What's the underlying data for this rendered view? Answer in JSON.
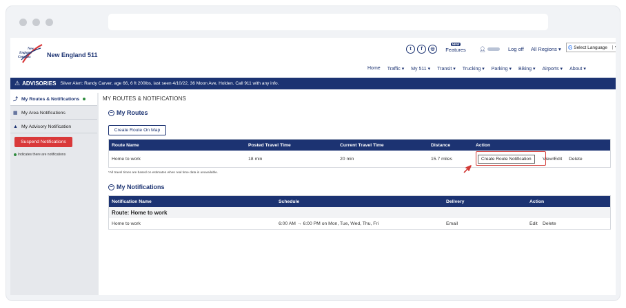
{
  "header": {
    "brand": "New England 511",
    "logo_text": "New England Compass",
    "social_icons": [
      "twitter-icon",
      "facebook-icon",
      "instagram-icon"
    ],
    "features_badge": "NEW",
    "features_label": "Features",
    "logoff_label": "Log off",
    "regions_label": "All Regions ▾",
    "language_label": "Select Language",
    "language_arrow": "▼",
    "nav": [
      "Home",
      "Traffic ▾",
      "My 511 ▾",
      "Transit ▾",
      "Trucking ▾",
      "Parking ▾",
      "Biking ▾",
      "Airports ▾",
      "About ▾"
    ]
  },
  "advisory": {
    "title": "ADVISORIES",
    "text": "Silver Alert: Randy Carver, age 66, 6 ft 200lbs, last seen 4/10/22, 36 Moon Ave, Holden. Call 911 with any info."
  },
  "sidebar": {
    "items": [
      {
        "label": "My Routes & Notifications",
        "icon": "route-icon"
      },
      {
        "label": "My Area Notifications",
        "icon": "map-icon"
      },
      {
        "label": "My Advisory Notification",
        "icon": "warning-icon"
      }
    ],
    "suspend_label": "Suspend Notifications",
    "indicator_note": "Indicates there are notifications"
  },
  "main": {
    "breadcrumb": "MY ROUTES & NOTIFICATIONS",
    "routes": {
      "heading": "My Routes",
      "create_button": "Create Route On Map",
      "columns": [
        "Route Name",
        "Posted Travel Time",
        "Current Travel Time",
        "Distance",
        "Action"
      ],
      "rows": [
        {
          "name": "Home to work",
          "posted": "18 min",
          "current": "20 min",
          "distance": "15.7 miles",
          "action_primary": "Create Route Notification",
          "action_view": "View/Edit",
          "action_delete": "Delete"
        }
      ],
      "footnote": "*All travel times are based on estimates when real time data is unavailable."
    },
    "notifications": {
      "heading": "My Notifications",
      "columns": [
        "Notification Name",
        "Schedule",
        "Delivery",
        "Action"
      ],
      "group_label": "Route: Home to work",
      "rows": [
        {
          "name": "Home to work",
          "schedule": "6:00 AM → 6:00 PM on Mon, Tue, Wed, Thu, Fri",
          "delivery": "Email",
          "action_edit": "Edit",
          "action_delete": "Delete"
        }
      ]
    }
  },
  "colors": {
    "primary": "#1c3372",
    "danger": "#d9393a",
    "highlight": "#d23a36",
    "indicator": "#2e8b3d"
  }
}
